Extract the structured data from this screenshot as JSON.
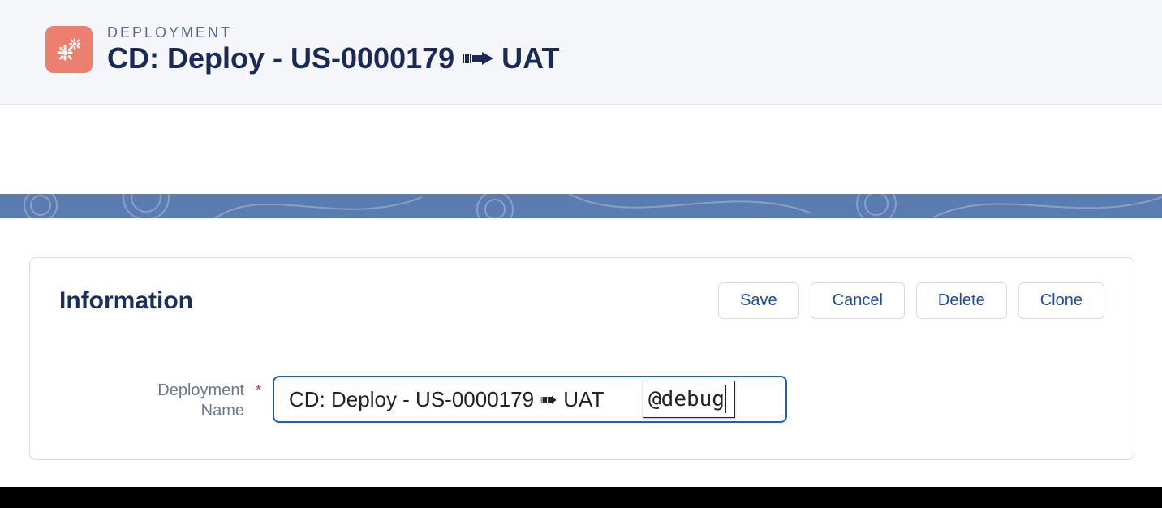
{
  "header": {
    "eyebrow": "DEPLOYMENT",
    "title_prefix": "CD: Deploy - US-0000179",
    "title_suffix": "UAT"
  },
  "panel": {
    "title": "Information",
    "buttons": {
      "save": "Save",
      "cancel": "Cancel",
      "delete": "Delete",
      "clone": "Clone"
    },
    "field": {
      "label_line1": "Deployment",
      "label_line2": "Name",
      "value": "CD: Deploy - US-0000179 ➠ UAT ",
      "overlay": "@debug"
    }
  }
}
